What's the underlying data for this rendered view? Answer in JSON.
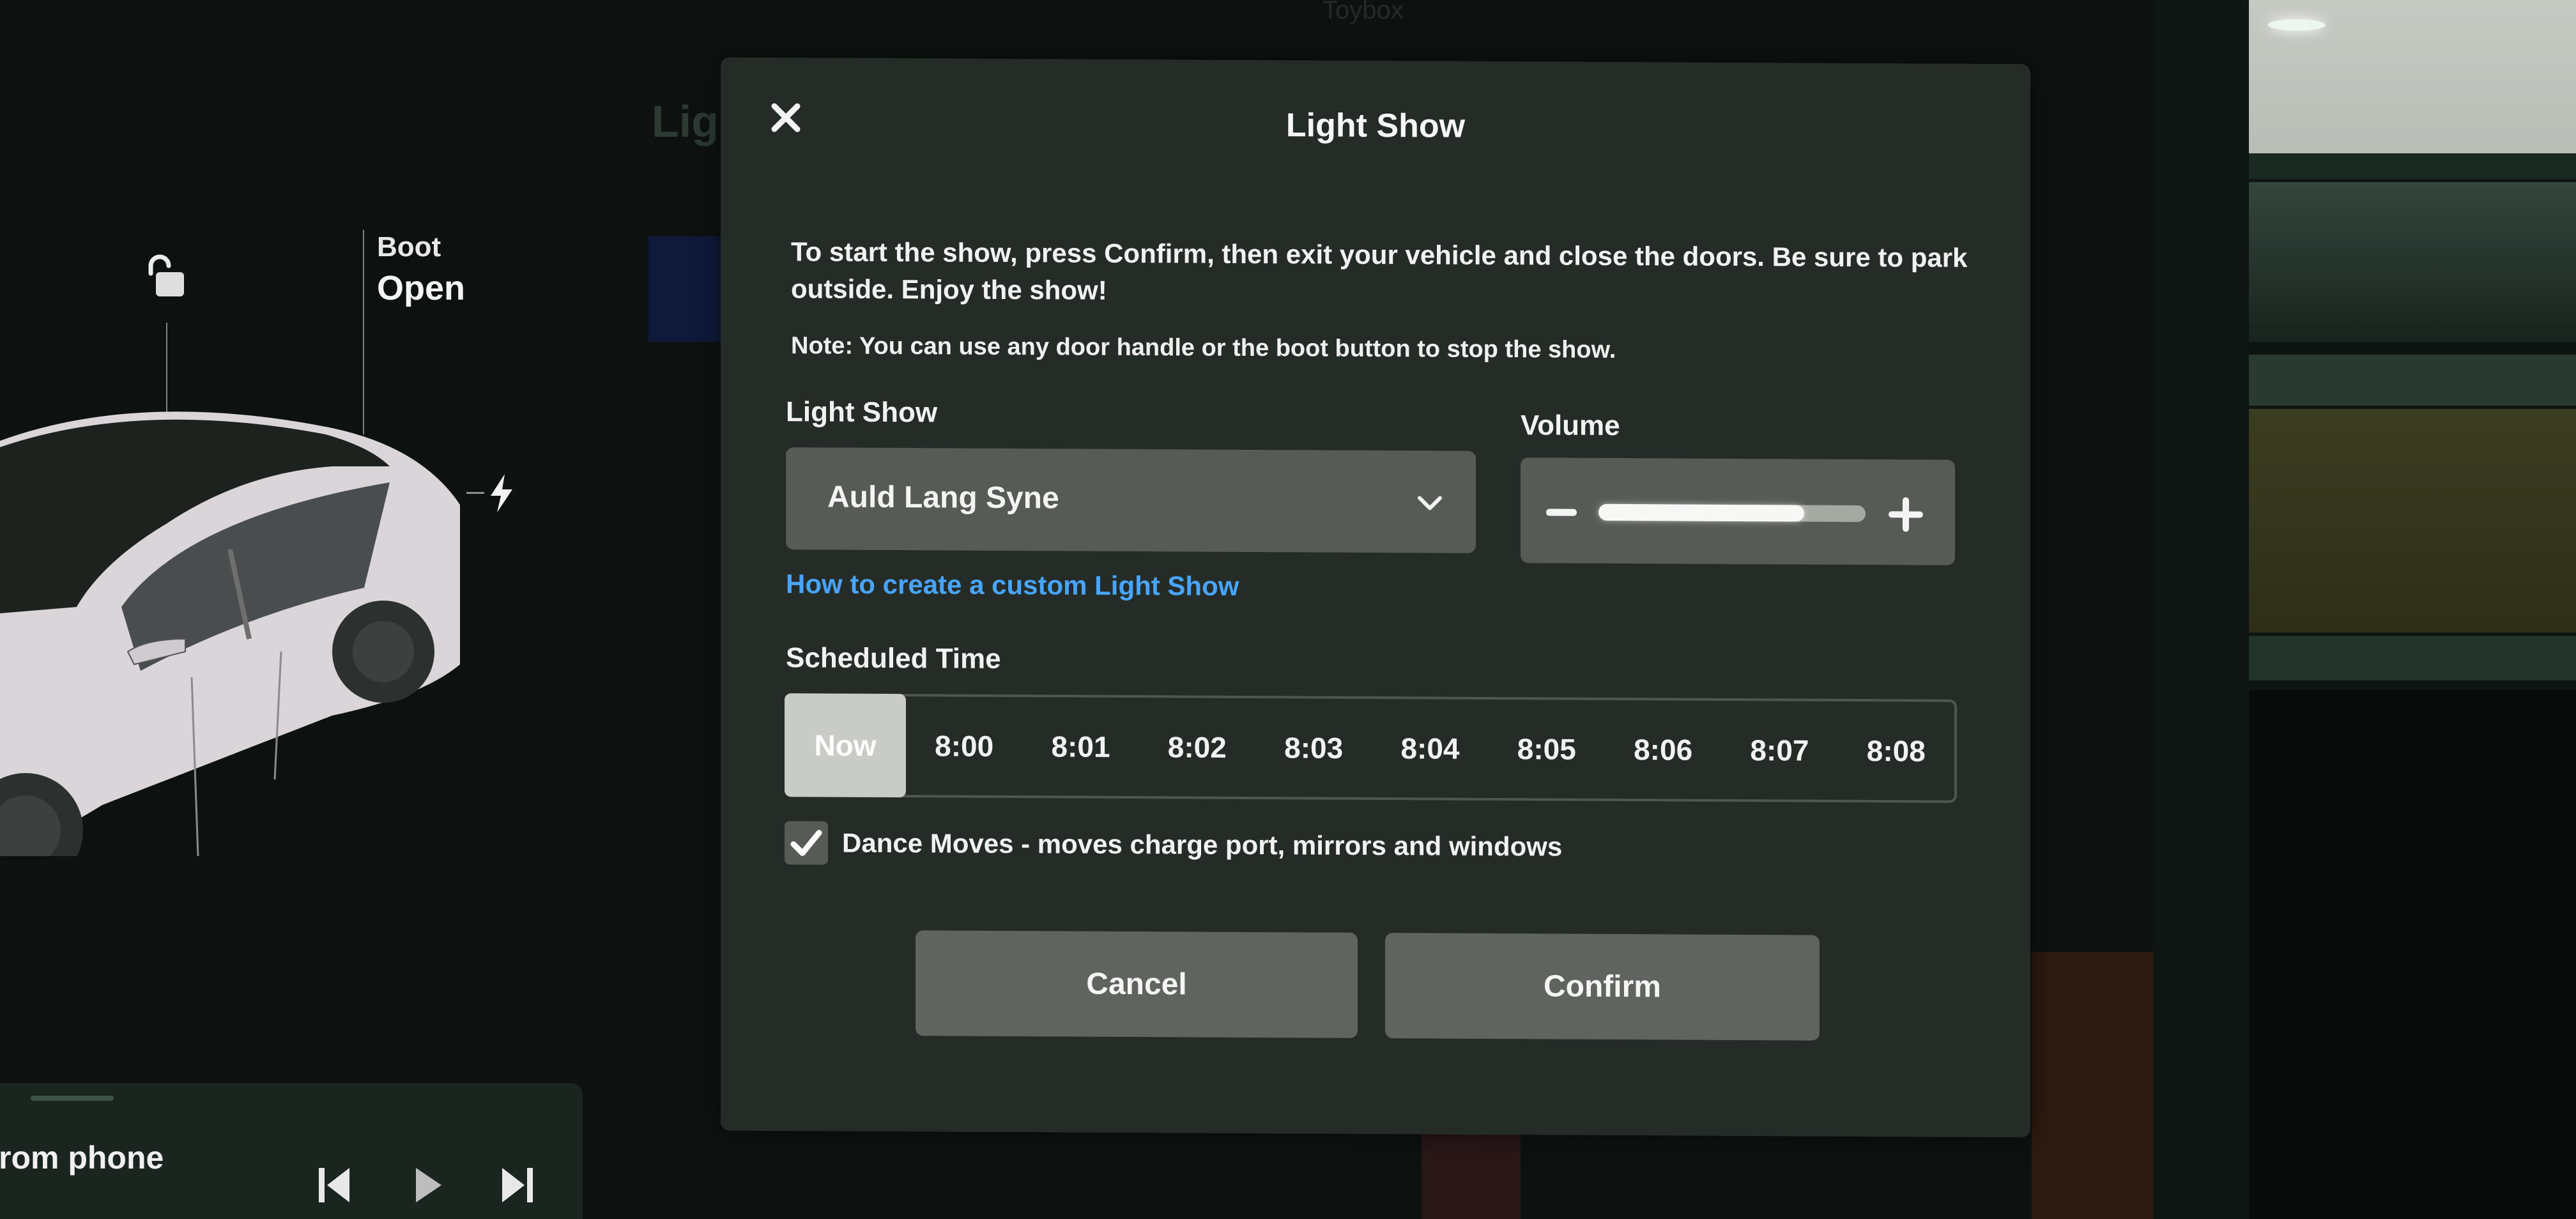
{
  "background": {
    "tabs": [
      "Toybox"
    ],
    "heading_fragment": "Lig"
  },
  "vehicle": {
    "lock_state_icon": "unlocked-padlock-icon",
    "boot_label": "Boot",
    "boot_status": "Open",
    "charge_port_icon": "lightning-bolt-icon"
  },
  "media": {
    "source_text": "rom phone",
    "controls": [
      "previous-track",
      "play",
      "next-track"
    ]
  },
  "modal": {
    "title": "Light Show",
    "close_icon": "close-x-icon",
    "intro": "To start the show, press Confirm, then exit your vehicle and close the doors. Be sure to park outside. Enjoy the show!",
    "note": "Note: You can use any door handle or the boot button to stop the show.",
    "light_show": {
      "label": "Light Show",
      "selected": "Auld Lang Syne"
    },
    "volume": {
      "label": "Volume",
      "level_percent": 77
    },
    "custom_link": "How to create a custom Light Show",
    "scheduled_time": {
      "label": "Scheduled Time",
      "options": [
        "Now",
        "8:00",
        "8:01",
        "8:02",
        "8:03",
        "8:04",
        "8:05",
        "8:06",
        "8:07",
        "8:08"
      ],
      "selected": "Now"
    },
    "dance_moves": {
      "checked": true,
      "label": "Dance Moves - moves charge port, mirrors and windows"
    },
    "buttons": {
      "cancel": "Cancel",
      "confirm": "Confirm"
    }
  },
  "colors": {
    "link": "#48a5ff",
    "modal_bg": "#252c28",
    "control_bg": "#575b55",
    "selected_time_bg": "#c9cbc6"
  }
}
